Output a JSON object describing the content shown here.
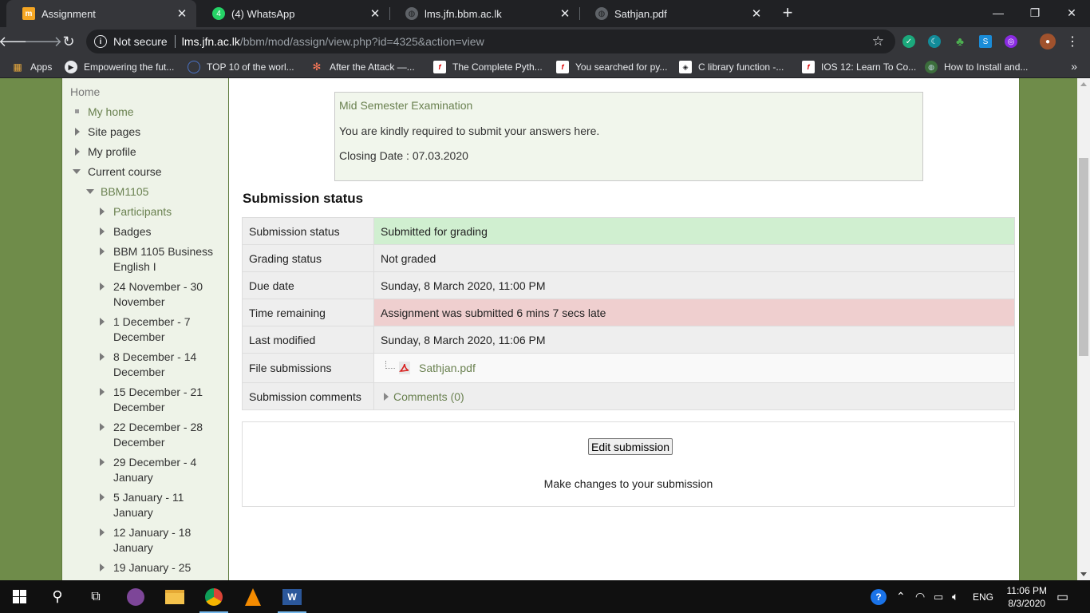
{
  "tabs": [
    {
      "title": "Assignment",
      "active": true
    },
    {
      "title": "(4) WhatsApp",
      "active": false
    },
    {
      "title": "lms.jfn.bbm.ac.lk",
      "active": false
    },
    {
      "title": "Sathjan.pdf",
      "active": false
    }
  ],
  "toolbar": {
    "not_secure": "Not secure",
    "host": "lms.jfn.ac.lk",
    "path": "/bbm/mod/assign/view.php?id=4325&action=view"
  },
  "bookmarks": [
    "Apps",
    "Empowering the fut...",
    "TOP 10 of the worl...",
    "After the Attack —...",
    "The Complete Pyth...",
    "You searched for py...",
    "C library function -...",
    "IOS 12: Learn To Co...",
    "How to Install and..."
  ],
  "nav": {
    "home": "Home",
    "my_home": "My home",
    "site_pages": "Site pages",
    "my_profile": "My profile",
    "current_course": "Current course",
    "course_code": "BBM1105",
    "participants": "Participants",
    "badges": "Badges",
    "items": [
      [
        "BBM 1105 Business",
        "English I"
      ],
      [
        "24 November - 30",
        "November"
      ],
      [
        "1 December - 7",
        "December"
      ],
      [
        "8 December - 14",
        "December"
      ],
      [
        "15 December - 21",
        "December"
      ],
      [
        "22 December - 28",
        "December"
      ],
      [
        "29 December - 4",
        "January"
      ],
      [
        "5 January - 11",
        "January"
      ],
      [
        "12 January - 18",
        "January"
      ],
      [
        "19 January - 25",
        ""
      ]
    ]
  },
  "intro": {
    "heading": "Mid Semester Examination",
    "instruction": "You are kindly required to submit your answers here.",
    "closing": "Closing Date : 07.03.2020"
  },
  "status": {
    "title": "Submission status",
    "rows": [
      {
        "label": "Submission status",
        "value": "Submitted for grading"
      },
      {
        "label": "Grading status",
        "value": "Not graded"
      },
      {
        "label": "Due date",
        "value": "Sunday, 8 March 2020, 11:00 PM"
      },
      {
        "label": "Time remaining",
        "value": "Assignment was submitted 6 mins 7 secs late"
      },
      {
        "label": "Last modified",
        "value": "Sunday, 8 March 2020, 11:06 PM"
      },
      {
        "label": "File submissions",
        "value": "Sathjan.pdf"
      },
      {
        "label": "Submission comments",
        "value": "Comments (0)"
      }
    ],
    "colors": {
      "submitted": "#d0efd0",
      "late": "#efcfcf"
    }
  },
  "edit": {
    "button": "Edit submission",
    "help": "Make changes to your submission"
  },
  "taskbar": {
    "language": "ENG",
    "time": "11:06 PM",
    "date": "8/3/2020"
  }
}
